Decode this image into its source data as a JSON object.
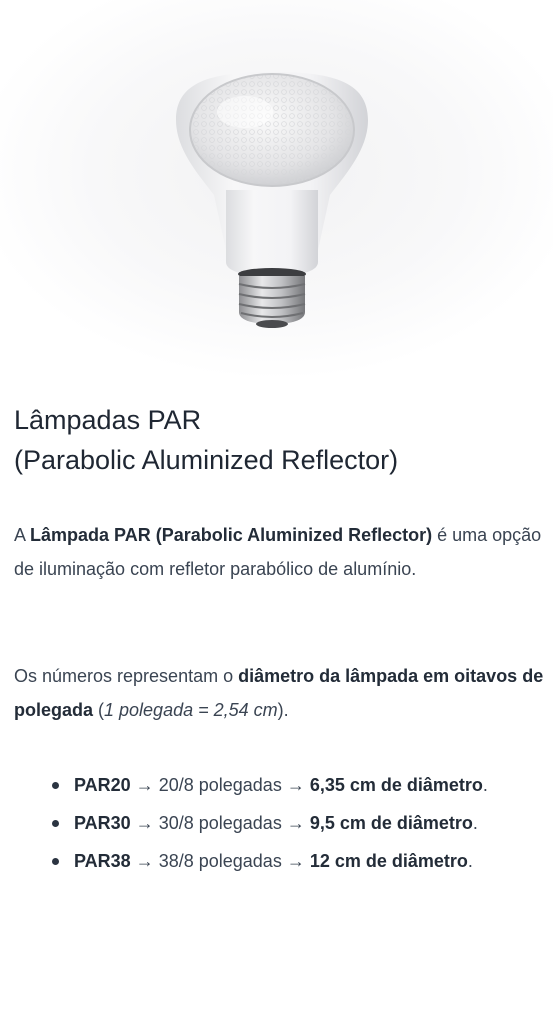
{
  "image": {
    "icon": "par-lamp-bulb-illustration"
  },
  "title": {
    "line1": "Lâmpadas PAR",
    "line2": "(Parabolic Aluminized Reflector)"
  },
  "paragraph1": {
    "prefix": "A ",
    "bold": "Lâmpada PAR (Parabolic Aluminized Reflector)",
    "suffix": " é uma opção de iluminação com refletor parabólico de alumínio."
  },
  "paragraph2": {
    "prefix": "Os números representam o ",
    "bold": "diâmetro da lâmpada em oitavos de polegada",
    "middle": " (",
    "italic": "1 polegada = 2,54 cm",
    "suffix": ")."
  },
  "bullets": [
    {
      "name": "PAR20",
      "middle": " → 20/8 polegadas → ",
      "result": "6,35 cm de diâmetro",
      "end": "."
    },
    {
      "name": "PAR30",
      "middle": " → 30/8 polegadas → ",
      "result": "9,5 cm de diâmetro",
      "end": "."
    },
    {
      "name": "PAR38",
      "middle": " → 38/8 polegadas → ",
      "result": "12 cm de diâmetro",
      "end": "."
    }
  ]
}
